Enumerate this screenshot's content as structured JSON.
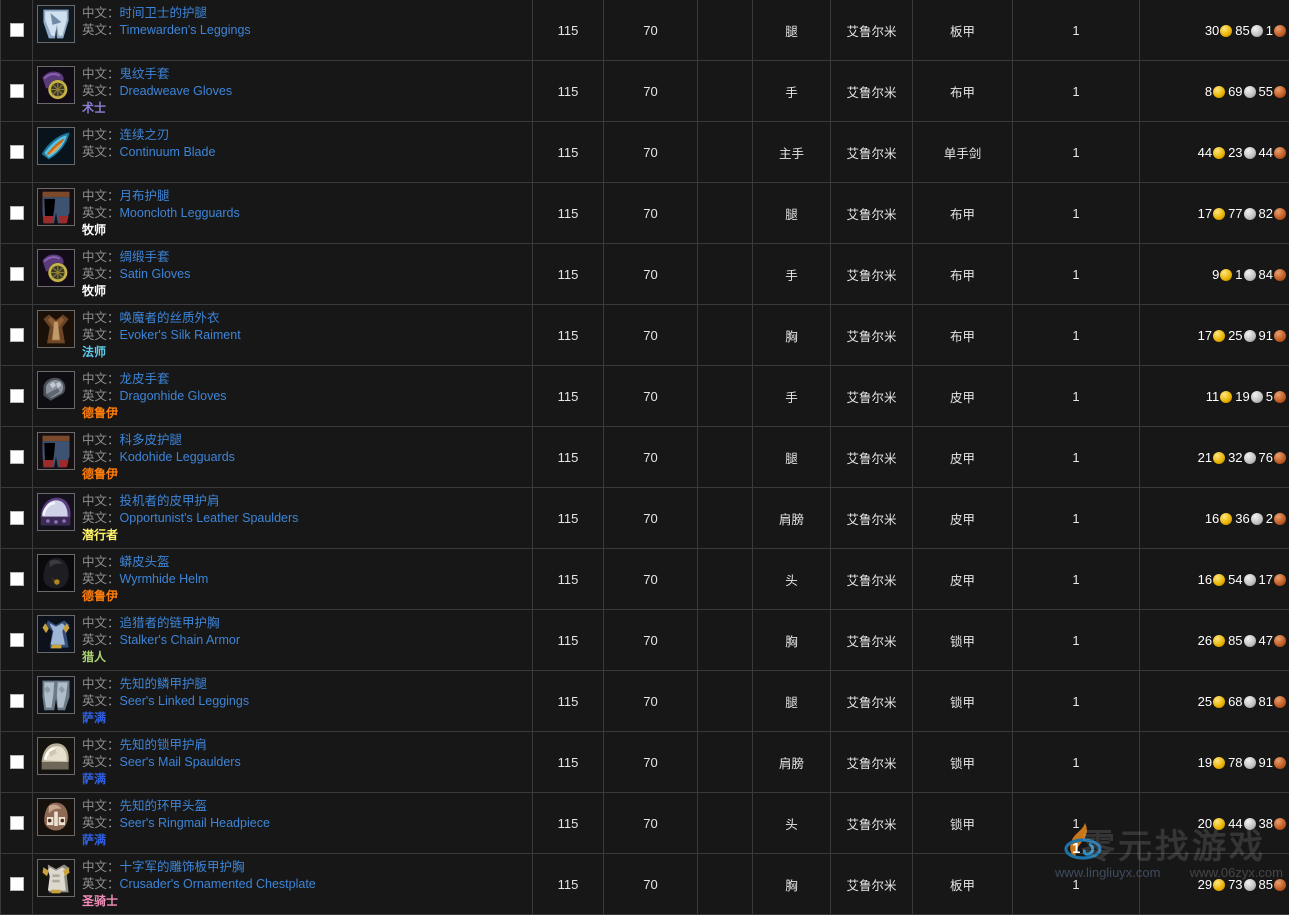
{
  "labels": {
    "cn_prefix": "中文：",
    "en_prefix": "英文：",
    "column_keys": [
      "check",
      "name",
      "item_level",
      "req_level",
      "blank",
      "slot",
      "source",
      "armor_type",
      "quantity",
      "price"
    ]
  },
  "class_colors": {
    "warlock": "#8a7fd4",
    "priest": "#ffffff",
    "mage": "#5ecbe8",
    "druid": "#ff7d0a",
    "rogue": "#fff569",
    "hunter": "#a9d271",
    "shaman": "#2f5fe0",
    "paladin": "#f48cba"
  },
  "coin_colors": {
    "gold": "#e8b200",
    "silver": "#c0c0c0",
    "copper": "#c05a22"
  },
  "watermark": {
    "cjk_text": "零元找游戏",
    "url_left": "www.lingliuyx.com",
    "url_right": "www.06zyx.com",
    "logo_digit": "1"
  },
  "rows": [
    {
      "cn": "时间卫士的护腿",
      "en": "Timewarden's Leggings",
      "cls": "",
      "cls_key": "",
      "item_level": "115",
      "req_level": "70",
      "blank": "",
      "slot": "腿",
      "source": "艾鲁尔米",
      "armor_type": "板甲",
      "quantity": "1",
      "gold": "30",
      "silver": "85",
      "copper": "1",
      "icon": "legs-blue-plate"
    },
    {
      "cn": "鬼纹手套",
      "en": "Dreadweave Gloves",
      "cls": "术士",
      "cls_key": "warlock",
      "item_level": "115",
      "req_level": "70",
      "blank": "",
      "slot": "手",
      "source": "艾鲁尔米",
      "armor_type": "布甲",
      "quantity": "1",
      "gold": "8",
      "silver": "69",
      "copper": "55",
      "icon": "gloves-purple-gold"
    },
    {
      "cn": "连续之刃",
      "en": "Continuum Blade",
      "cls": "",
      "cls_key": "",
      "item_level": "115",
      "req_level": "70",
      "blank": "",
      "slot": "主手",
      "source": "艾鲁尔米",
      "armor_type": "单手剑",
      "quantity": "1",
      "gold": "44",
      "silver": "23",
      "copper": "44",
      "icon": "sword-orange-cyan"
    },
    {
      "cn": "月布护腿",
      "en": "Mooncloth Legguards",
      "cls": "牧师",
      "cls_key": "priest",
      "item_level": "115",
      "req_level": "70",
      "blank": "",
      "slot": "腿",
      "source": "艾鲁尔米",
      "armor_type": "布甲",
      "quantity": "1",
      "gold": "17",
      "silver": "77",
      "copper": "82",
      "icon": "pants-blue-red"
    },
    {
      "cn": "绸缎手套",
      "en": "Satin Gloves",
      "cls": "牧师",
      "cls_key": "priest",
      "item_level": "115",
      "req_level": "70",
      "blank": "",
      "slot": "手",
      "source": "艾鲁尔米",
      "armor_type": "布甲",
      "quantity": "1",
      "gold": "9",
      "silver": "1",
      "copper": "84",
      "icon": "gloves-purple-gold"
    },
    {
      "cn": "唤魔者的丝质外衣",
      "en": "Evoker's Silk Raiment",
      "cls": "法师",
      "cls_key": "mage",
      "item_level": "115",
      "req_level": "70",
      "blank": "",
      "slot": "胸",
      "source": "艾鲁尔米",
      "armor_type": "布甲",
      "quantity": "1",
      "gold": "17",
      "silver": "25",
      "copper": "91",
      "icon": "robe-brown"
    },
    {
      "cn": "龙皮手套",
      "en": "Dragonhide Gloves",
      "cls": "德鲁伊",
      "cls_key": "druid",
      "item_level": "115",
      "req_level": "70",
      "blank": "",
      "slot": "手",
      "source": "艾鲁尔米",
      "armor_type": "皮甲",
      "quantity": "1",
      "gold": "11",
      "silver": "19",
      "copper": "5",
      "icon": "gloves-steel"
    },
    {
      "cn": "科多皮护腿",
      "en": "Kodohide Legguards",
      "cls": "德鲁伊",
      "cls_key": "druid",
      "item_level": "115",
      "req_level": "70",
      "blank": "",
      "slot": "腿",
      "source": "艾鲁尔米",
      "armor_type": "皮甲",
      "quantity": "1",
      "gold": "21",
      "silver": "32",
      "copper": "76",
      "icon": "pants-blue-red"
    },
    {
      "cn": "投机者的皮甲护肩",
      "en": "Opportunist's Leather Spaulders",
      "cls": "潜行者",
      "cls_key": "rogue",
      "item_level": "115",
      "req_level": "70",
      "blank": "",
      "slot": "肩膀",
      "source": "艾鲁尔米",
      "armor_type": "皮甲",
      "quantity": "1",
      "gold": "16",
      "silver": "36",
      "copper": "2",
      "icon": "shoulder-purple"
    },
    {
      "cn": "蟒皮头盔",
      "en": "Wyrmhide Helm",
      "cls": "德鲁伊",
      "cls_key": "druid",
      "item_level": "115",
      "req_level": "70",
      "blank": "",
      "slot": "头",
      "source": "艾鲁尔米",
      "armor_type": "皮甲",
      "quantity": "1",
      "gold": "16",
      "silver": "54",
      "copper": "17",
      "icon": "helm-dark-hood"
    },
    {
      "cn": "追猎者的链甲护胸",
      "en": "Stalker's Chain Armor",
      "cls": "猎人",
      "cls_key": "hunter",
      "item_level": "115",
      "req_level": "70",
      "blank": "",
      "slot": "胸",
      "source": "艾鲁尔米",
      "armor_type": "锁甲",
      "quantity": "1",
      "gold": "26",
      "silver": "85",
      "copper": "47",
      "icon": "chest-blue-gold"
    },
    {
      "cn": "先知的鳞甲护腿",
      "en": "Seer's Linked Leggings",
      "cls": "萨满",
      "cls_key": "shaman",
      "item_level": "115",
      "req_level": "70",
      "blank": "",
      "slot": "腿",
      "source": "艾鲁尔米",
      "armor_type": "锁甲",
      "quantity": "1",
      "gold": "25",
      "silver": "68",
      "copper": "81",
      "icon": "pants-silver"
    },
    {
      "cn": "先知的锁甲护肩",
      "en": "Seer's Mail Spaulders",
      "cls": "萨满",
      "cls_key": "shaman",
      "item_level": "115",
      "req_level": "70",
      "blank": "",
      "slot": "肩膀",
      "source": "艾鲁尔米",
      "armor_type": "锁甲",
      "quantity": "1",
      "gold": "19",
      "silver": "78",
      "copper": "91",
      "icon": "shoulder-bone"
    },
    {
      "cn": "先知的环甲头盔",
      "en": "Seer's Ringmail Headpiece",
      "cls": "萨满",
      "cls_key": "shaman",
      "item_level": "115",
      "req_level": "70",
      "blank": "",
      "slot": "头",
      "source": "艾鲁尔米",
      "armor_type": "锁甲",
      "quantity": "1",
      "gold": "20",
      "silver": "44",
      "copper": "38",
      "icon": "helm-bone"
    },
    {
      "cn": "十字军的雕饰板甲护胸",
      "en": "Crusader's Ornamented Chestplate",
      "cls": "圣骑士",
      "cls_key": "paladin",
      "item_level": "115",
      "req_level": "70",
      "blank": "",
      "slot": "胸",
      "source": "艾鲁尔米",
      "armor_type": "板甲",
      "quantity": "1",
      "gold": "29",
      "silver": "73",
      "copper": "85",
      "icon": "chest-plate-white"
    }
  ]
}
